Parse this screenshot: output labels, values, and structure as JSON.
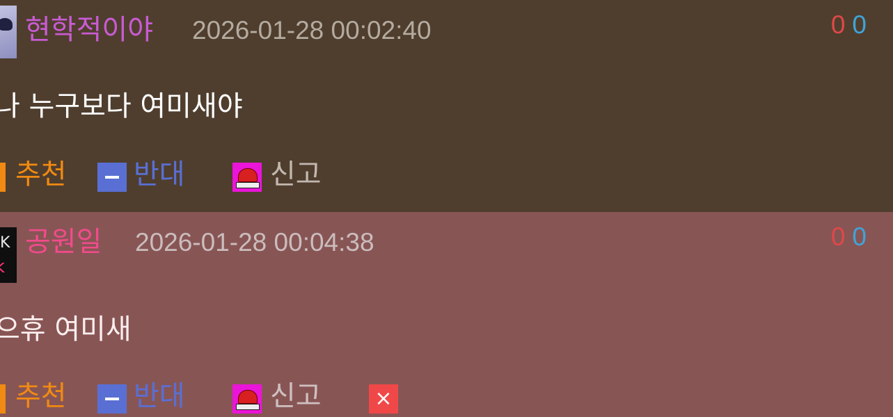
{
  "comments": [
    {
      "author": "현학적이야",
      "timestamp": "2026-01-28 00:02:40",
      "upvotes": "0",
      "downvotes": "0",
      "text": "나 누구보다 여미새야",
      "actions": {
        "recommend": "추천",
        "oppose": "반대",
        "report": "신고"
      }
    },
    {
      "author": "공원일",
      "timestamp": "2026-01-28 00:04:38",
      "upvotes": "0",
      "downvotes": "0",
      "text": "으휴 여미새",
      "actions": {
        "recommend": "추천",
        "oppose": "반대",
        "report": "신고",
        "delete_icon": "×"
      }
    }
  ],
  "colors": {
    "comment1_bg": "#4f3e2e",
    "comment2_bg": "#885555",
    "recommend": "#f08a12",
    "oppose": "#5a6fd4",
    "report_icon": "#ea15d8",
    "delete_icon": "#f04848",
    "upvote_count": "#e04848",
    "downvote_count": "#3fa4d8"
  },
  "icons": {
    "recommend": "thumb-up-icon",
    "oppose": "minus-icon",
    "report": "siren-icon",
    "delete": "close-icon"
  }
}
